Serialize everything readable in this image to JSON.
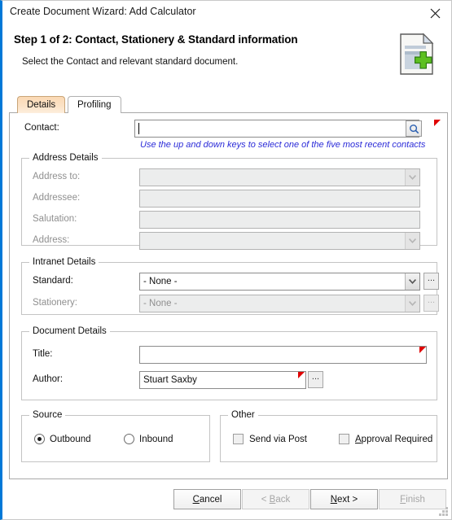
{
  "window": {
    "title": "Create Document Wizard: Add Calculator",
    "close_icon": "close-icon"
  },
  "header": {
    "step_title": "Step 1 of 2: Contact, Stationery & Standard information",
    "subtitle": "Select the Contact and relevant standard document.",
    "icon": "new-document-icon"
  },
  "tabs": [
    {
      "label": "Details",
      "active": true
    },
    {
      "label": "Profiling",
      "active": false
    }
  ],
  "contact": {
    "label": "Contact:",
    "value": "",
    "search_icon": "search-icon",
    "hint": "Use the up and down keys to select one of the five most recent contacts",
    "required": true
  },
  "address_details": {
    "title": "Address Details",
    "fields": [
      {
        "label": "Address to:",
        "value": "",
        "type": "combobox",
        "disabled": true
      },
      {
        "label": "Addressee:",
        "value": "",
        "type": "text",
        "disabled": true
      },
      {
        "label": "Salutation:",
        "value": "",
        "type": "text",
        "disabled": true
      },
      {
        "label": "Address:",
        "value": "",
        "type": "combobox",
        "disabled": true
      }
    ]
  },
  "intranet_details": {
    "title": "Intranet Details",
    "fields": [
      {
        "label": "Standard:",
        "value": "- None -",
        "type": "combobox",
        "disabled": false,
        "browse": "..."
      },
      {
        "label": "Stationery:",
        "value": "- None -",
        "type": "combobox",
        "disabled": true,
        "browse": "..."
      }
    ]
  },
  "document_details": {
    "title": "Document Details",
    "fields": [
      {
        "label": "Title:",
        "value": "",
        "required": true,
        "browse": null
      },
      {
        "label": "Author:",
        "value": "Stuart Saxby",
        "required": true,
        "browse": "..."
      }
    ]
  },
  "source": {
    "title": "Source",
    "options": [
      {
        "label": "Outbound",
        "selected": true
      },
      {
        "label": "Inbound",
        "selected": false
      }
    ]
  },
  "other": {
    "title": "Other",
    "options": [
      {
        "label": "Send via Post",
        "checked": false,
        "accel": ""
      },
      {
        "label": "Approval Required",
        "checked": false,
        "accel": "A"
      }
    ]
  },
  "footer": {
    "buttons": [
      {
        "label": "Cancel",
        "accel": "C",
        "disabled": false
      },
      {
        "label": "< Back",
        "accel": "B",
        "disabled": true
      },
      {
        "label": "Next >",
        "accel": "N",
        "disabled": false
      },
      {
        "label": "Finish",
        "accel": "F",
        "disabled": true
      }
    ]
  },
  "colors": {
    "accent_blue": "#0078d7",
    "tab_active": "#fbd9b4",
    "hint_blue": "#2b2bd8",
    "required_red": "#e00000"
  }
}
